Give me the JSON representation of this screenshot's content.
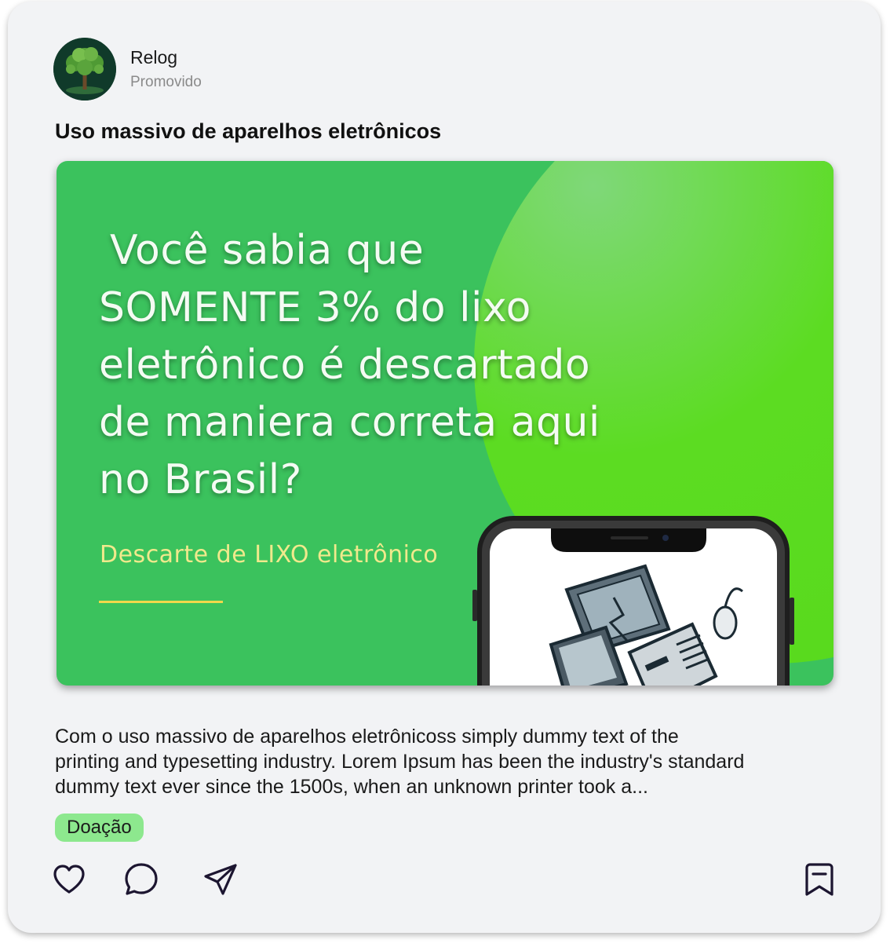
{
  "post": {
    "author": "Relog",
    "subtitle": "Promovido",
    "title": "Uso massivo de aparelhos eletrônicos",
    "banner": {
      "headline_lines": [
        "Você sabia que",
        "SOMENTE 3% do lixo",
        "eletrônico é descartado",
        "de maniera correta aqui",
        "no Brasil?"
      ],
      "subtitle": "Descarte de LIXO eletrônico"
    },
    "description_lines": [
      "Com o uso massivo de aparelhos eletrônicoss simply dummy text of the",
      "printing and typesetting industry. Lorem Ipsum has been the industry's standard",
      "dummy text ever since the 1500s, when an unknown printer took a..."
    ],
    "tag": "Doação"
  },
  "actions": {
    "left": [
      "heart-icon",
      "comment-icon",
      "share-icon"
    ],
    "right": [
      "bookmark-icon"
    ]
  },
  "colors": {
    "card_background": "#f2f3f5",
    "banner_green": "#3bc25d",
    "banner_accent_green": "#57d91b",
    "banner_subtitle": "#f0e98c",
    "tag_background": "#8de88e",
    "icon_stroke": "#1c1530"
  }
}
